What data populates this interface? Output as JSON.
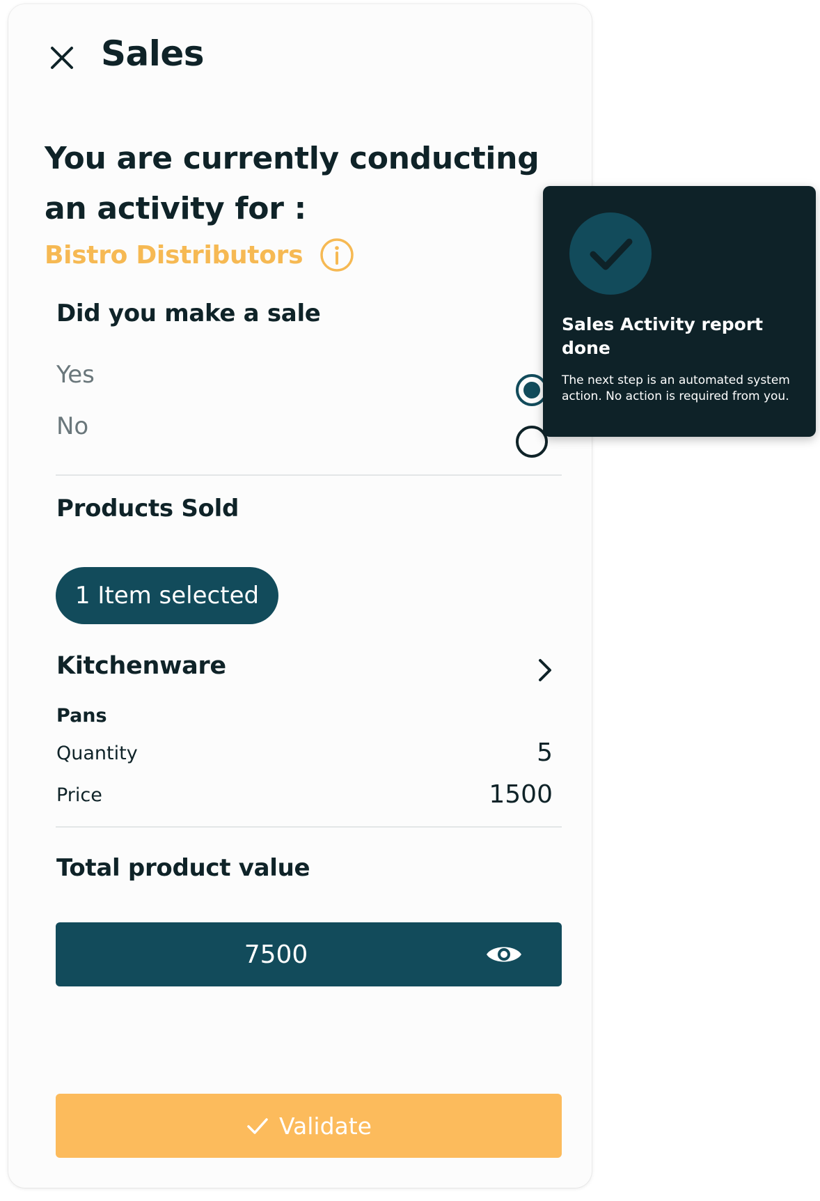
{
  "header": {
    "title": "Sales"
  },
  "intro": {
    "heading": "You are currently conducting an activity for :",
    "client_name": "Bistro Distributors"
  },
  "sale_question": {
    "title": "Did you make a sale",
    "options": [
      {
        "label": "Yes",
        "selected": true
      },
      {
        "label": "No",
        "selected": false
      }
    ]
  },
  "products": {
    "title": "Products Sold",
    "selected_chip": "1 Item selected",
    "category": "Kitchenware",
    "item": {
      "name": "Pans",
      "quantity_label": "Quantity",
      "quantity_value": "5",
      "price_label": "Price",
      "price_value": "1500"
    }
  },
  "total": {
    "title": "Total product value",
    "value": "7500"
  },
  "actions": {
    "validate_label": "Validate"
  },
  "toast": {
    "title": "Sales Activity report done",
    "body": "The next step is an automated system action. No action is required from you."
  },
  "colors": {
    "primary": "#124b5b",
    "accent": "#f6b953",
    "validate": "#fcbb5c",
    "toast_bg": "#0e2228",
    "text": "#0f2328"
  },
  "icons": {
    "close": "close-icon",
    "info": "info-icon",
    "chevron": "chevron-right-icon",
    "eye": "eye-icon",
    "check": "checkmark-icon",
    "success": "check-circle-icon"
  }
}
